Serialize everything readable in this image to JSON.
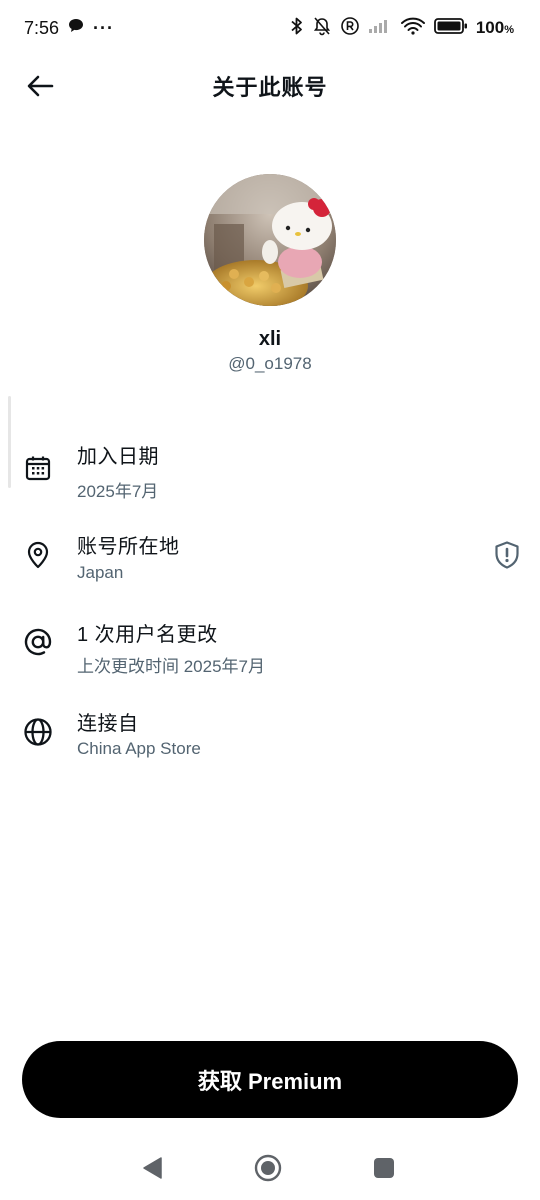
{
  "status_bar": {
    "time": "7:56",
    "dots": "···",
    "battery_percent": "100",
    "battery_unit": "%"
  },
  "header": {
    "title": "关于此账号",
    "back_icon": "arrow-left-icon"
  },
  "profile": {
    "display_name": "xli",
    "handle": "@0_o1978"
  },
  "info_items": [
    {
      "icon": "calendar-icon",
      "label": "加入日期",
      "value": "2025年7月"
    },
    {
      "icon": "location-pin-icon",
      "label": "账号所在地",
      "value": "Japan",
      "badge": "shield-alert-icon"
    },
    {
      "icon": "at-sign-icon",
      "label": "1 次用户名更改",
      "value": "上次更改时间 2025年7月"
    },
    {
      "icon": "globe-icon",
      "label": "连接自",
      "value": "China App Store"
    }
  ],
  "premium_button": {
    "label": "获取 Premium"
  },
  "colors": {
    "primary_text": "#0f1419",
    "secondary_text": "#536471",
    "button_bg": "#000000",
    "button_text": "#ffffff",
    "nav_icon": "#5f6368"
  }
}
